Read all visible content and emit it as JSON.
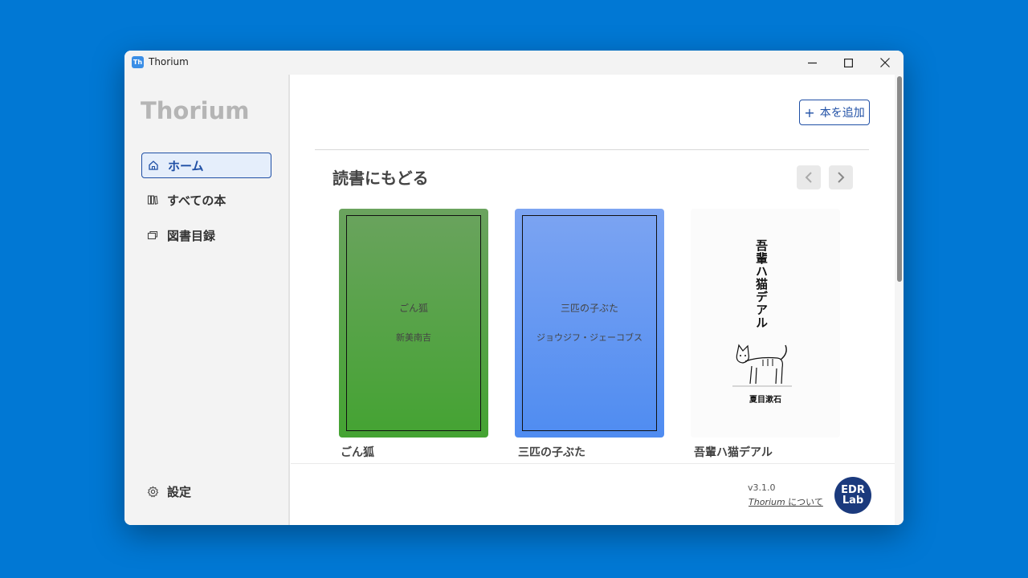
{
  "window": {
    "app_icon_text": "Th",
    "title": "Thorium",
    "controls": {
      "minimize": "minimize-icon",
      "maximize": "maximize-icon",
      "close": "close-icon"
    }
  },
  "sidebar": {
    "brand": "Thorium",
    "items": [
      {
        "label": "ホーム",
        "icon": "home-icon",
        "active": true
      },
      {
        "label": "すべての本",
        "icon": "books-icon",
        "active": false
      },
      {
        "label": "図書目録",
        "icon": "catalog-icon",
        "active": false
      }
    ],
    "settings_label": "設定"
  },
  "main": {
    "add_book_label": "本を追加",
    "section_title": "読書にもどる",
    "books": [
      {
        "cover_title": "ごん狐",
        "cover_author": "新美南吉",
        "caption": "ごん狐",
        "cover_color": "#4da83a"
      },
      {
        "cover_title": "三匹の子ぶた",
        "cover_author": "ジョウジフ・ジェーコブス",
        "caption": "三匹の子ぶた",
        "cover_color": "#5a8ff0"
      },
      {
        "cover_title": "吾輩ハ猫デアル",
        "cover_author": "夏目漱石",
        "caption": "吾輩ハ猫デアル",
        "cover_color": "#ffffff"
      }
    ]
  },
  "footer": {
    "version": "v3.1.0",
    "about_app": "Thorium",
    "about_suffix": " について",
    "logo_top": "EDR",
    "logo_bottom": "Lab"
  },
  "colors": {
    "desktop": "#0178d4",
    "accent": "#1f4fa5"
  }
}
